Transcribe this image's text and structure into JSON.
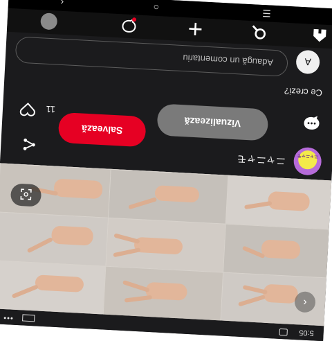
{
  "status": {
    "time": "5:05"
  },
  "pin": {
    "username": "ニャニャモ",
    "avatar_text": "ニャニャモ",
    "view_label": "Vizualizează",
    "save_label": "Salvează",
    "like_count": "11"
  },
  "comments": {
    "title": "Ce crezi?",
    "avatar_letter": "A",
    "placeholder": "Adaugă un comentariu"
  },
  "icons": {
    "grid_chevron": "chevron-icon",
    "lens": "lens-icon",
    "share": "share-icon",
    "comment": "comment-bubble-icon",
    "heart": "heart-icon",
    "nav": [
      "home-icon",
      "search-icon",
      "plus-icon",
      "chat-icon",
      "profile-avatar"
    ],
    "system": [
      "recents-icon",
      "home-circle-icon",
      "back-icon"
    ]
  },
  "colors": {
    "save_red": "#e60023",
    "background": "#1b1b1d"
  }
}
